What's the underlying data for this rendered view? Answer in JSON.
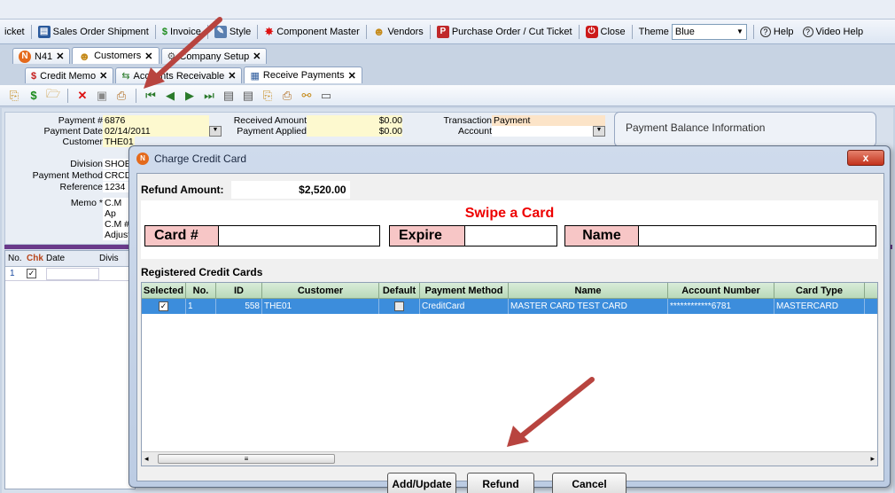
{
  "menu": {
    "items": [
      {
        "icon": "ticket-icon",
        "label": "icket"
      },
      {
        "icon": "truck-icon",
        "label": "Sales Order Shipment"
      },
      {
        "icon": "dollar-icon",
        "label": "Invoice"
      },
      {
        "icon": "style-icon",
        "label": "Style"
      },
      {
        "icon": "component-icon",
        "label": "Component Master"
      },
      {
        "icon": "vendor-icon",
        "label": "Vendors"
      },
      {
        "icon": "purchase-order-icon",
        "label": "Purchase Order / Cut Ticket"
      },
      {
        "icon": "close-icon",
        "label": "Close"
      }
    ],
    "theme_label": "Theme",
    "theme_value": "Blue",
    "help_label": "Help",
    "video_help_label": "Video Help"
  },
  "tabs_row1": [
    {
      "label": "N41"
    },
    {
      "label": "Customers"
    },
    {
      "label": "Company Setup"
    }
  ],
  "tabs_row2": [
    {
      "label": "Credit Memo"
    },
    {
      "label": "Accounts Receivable"
    },
    {
      "label": "Receive Payments"
    }
  ],
  "form": {
    "payment_no_label": "Payment #",
    "payment_no": "6876",
    "payment_date_label": "Payment Date",
    "payment_date": "02/14/2011",
    "customer_label": "Customer",
    "customer": "THE01",
    "division_label": "Division",
    "division": "SHOE",
    "payment_method_label": "Payment Method",
    "payment_method": "CRCD",
    "reference_label": "Reference",
    "reference": "1234",
    "memo_label": "Memo *",
    "memo_lines": [
      "C.M Ap",
      "C.M #",
      "Adjust"
    ],
    "received_amount_label": "Received Amount",
    "received_amount": "$0.00",
    "payment_applied_label": "Payment Applied",
    "payment_applied": "$0.00",
    "transaction_label": "Transaction",
    "transaction": "Payment",
    "account_label": "Account",
    "payment_balance_title": "Payment Balance Information"
  },
  "left_grid": {
    "headers": [
      "No.",
      "Chk",
      "Date",
      "Divis"
    ],
    "row_no": "1"
  },
  "dialog": {
    "title": "Charge Credit Card",
    "close_label": "x",
    "refund_amount_label": "Refund Amount:",
    "refund_amount": "$2,520.00",
    "swipe_label": "Swipe a Card",
    "card_label": "Card #",
    "expire_label": "Expire",
    "name_label": "Name",
    "registered_label": "Registered Credit Cards",
    "columns": [
      "Selected",
      "No.",
      "ID",
      "Customer",
      "Default",
      "Payment Method",
      "Name",
      "Account Number",
      "Card Type"
    ],
    "row": {
      "no": "1",
      "id": "558",
      "customer": "THE01",
      "payment_method": "CreditCard",
      "name": "MASTER CARD TEST CARD",
      "account_number": "************6781",
      "card_type": "MASTERCARD"
    },
    "buttons": {
      "add_update": "Add/Update",
      "refund": "Refund",
      "cancel": "Cancel"
    }
  }
}
